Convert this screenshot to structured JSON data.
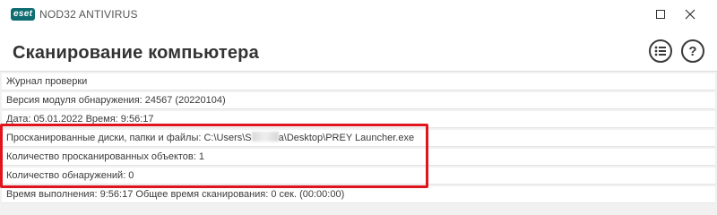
{
  "titlebar": {
    "logo_text": "eset",
    "product": "NOD32 ANTIVIRUS"
  },
  "header": {
    "title": "Сканирование компьютера",
    "list_icon": "list-circle-icon",
    "help_icon": "help-circle-icon",
    "help_glyph": "?"
  },
  "log": {
    "rows": [
      "Журнал проверки",
      "Версия модуля обнаружения: 24567 (20220104)",
      "Дата: 05.01.2022  Время: 9:56:17",
      "",
      "Количество просканированных объектов: 1",
      "Количество обнаружений: 0",
      "Время выполнения: 9:56:17  Общее время сканирования: 0 сек. (00:00:00)"
    ],
    "scanned_path": {
      "before": "Просканированные диски, папки и файлы: C:\\Users\\S",
      "after": "a\\Desktop\\PREY Launcher.exe"
    }
  },
  "colors": {
    "highlight": "#e0141d",
    "logo_bg": "#0f6d72"
  }
}
